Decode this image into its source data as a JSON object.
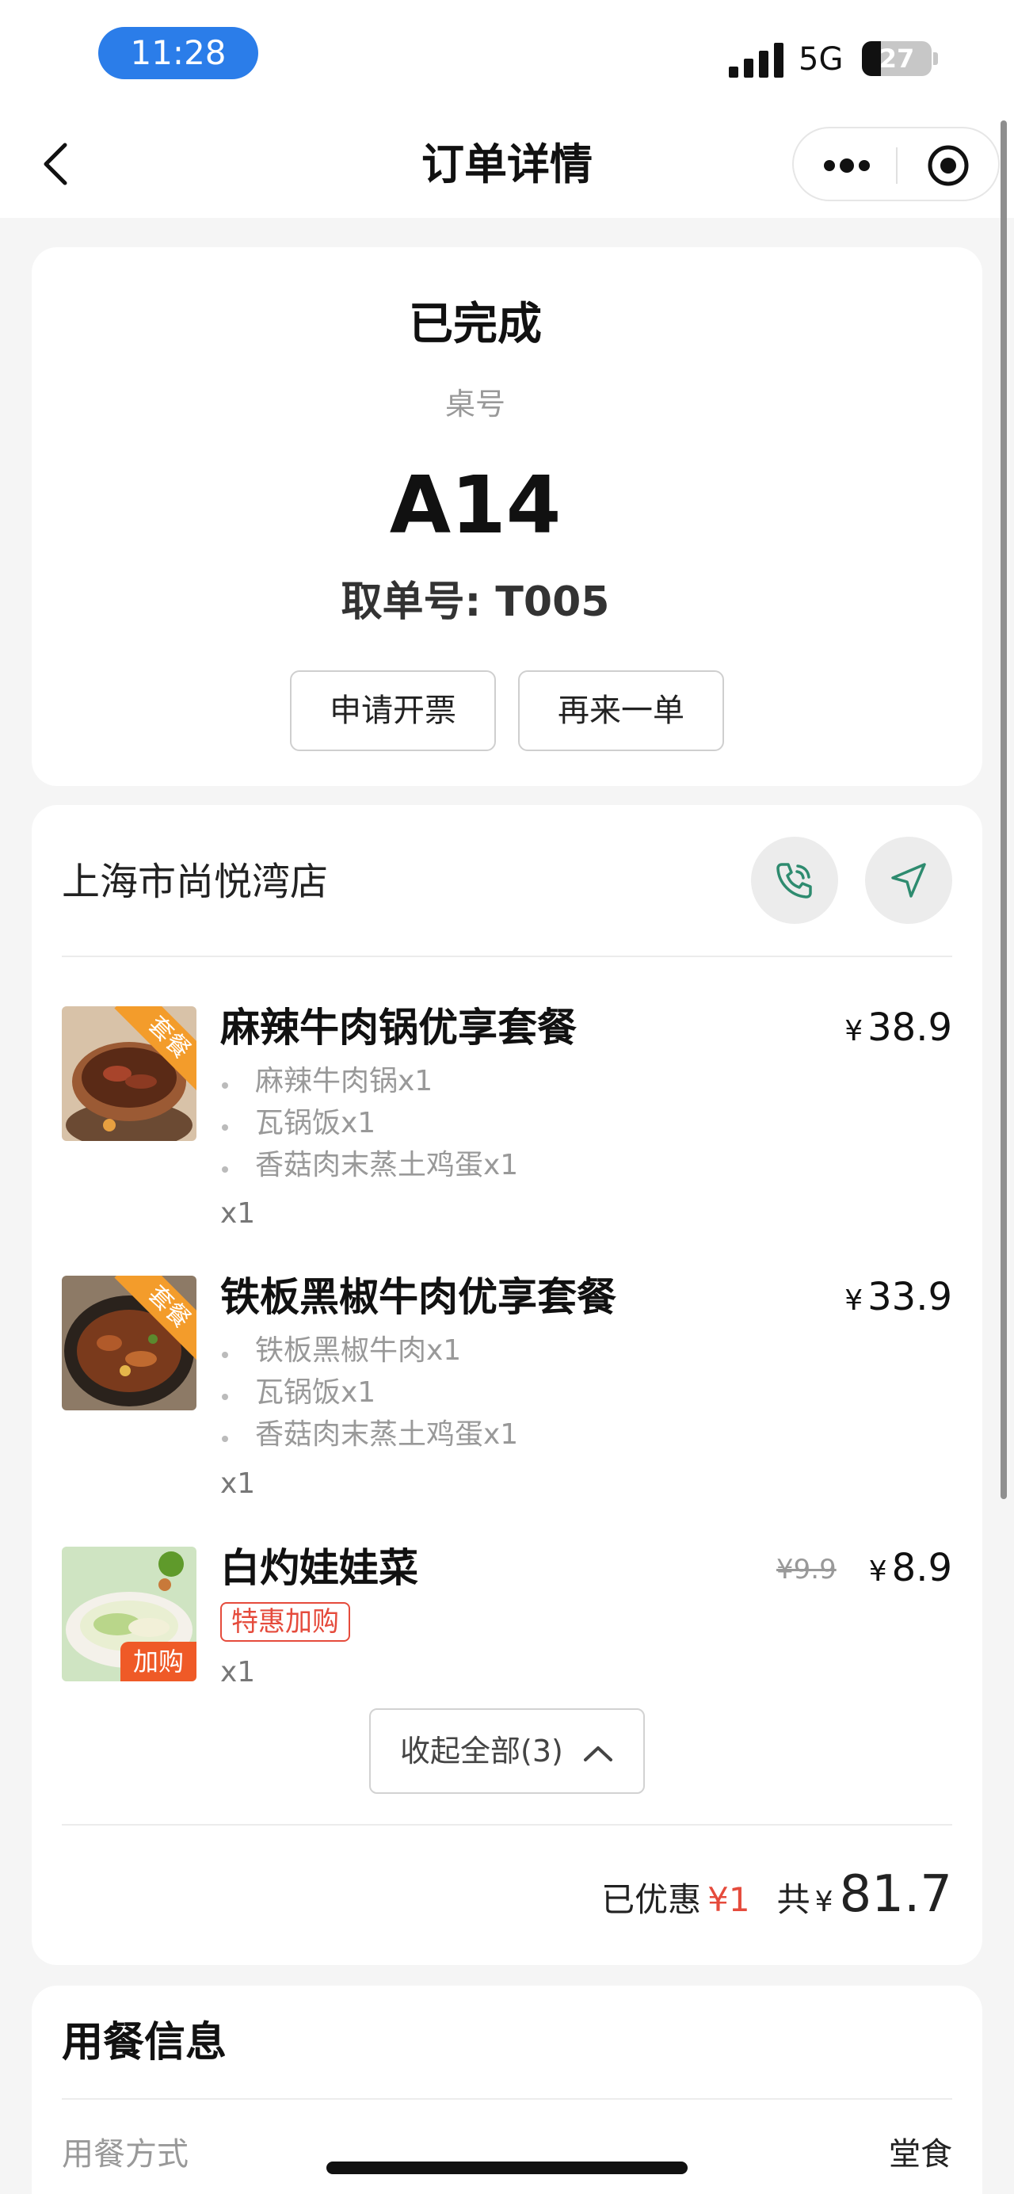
{
  "status_bar": {
    "time": "11:28",
    "network": "5G",
    "battery": "27",
    "battery_level": 0.27
  },
  "nav": {
    "title": "订单详情"
  },
  "order_status": {
    "status": "已完成",
    "table_label": "桌号",
    "table_number": "A14",
    "pickup": "取单号: T005",
    "invoice_button": "申请开票",
    "reorder_button": "再来一单"
  },
  "store": {
    "name": "上海市尚悦湾店"
  },
  "items": [
    {
      "name": "麻辣牛肉锅优享套餐",
      "price": "38.9",
      "currency": "¥",
      "badge": "套餐",
      "sub_items": [
        "麻辣牛肉锅x1",
        "瓦锅饭x1",
        "香菇肉末蒸土鸡蛋x1"
      ],
      "qty": "x1"
    },
    {
      "name": "铁板黑椒牛肉优享套餐",
      "price": "33.9",
      "currency": "¥",
      "badge": "套餐",
      "sub_items": [
        "铁板黑椒牛肉x1",
        "瓦锅饭x1",
        "香菇肉末蒸土鸡蛋x1"
      ],
      "qty": "x1"
    },
    {
      "name": "白灼娃娃菜",
      "price": "8.9",
      "original_price": "¥9.9",
      "currency": "¥",
      "badge": "加购",
      "promo_tag": "特惠加购",
      "qty": "x1"
    }
  ],
  "collapse_button": "收起全部(3)",
  "summary": {
    "discount_label": "已优惠",
    "discount_amount": "¥1",
    "total_label": "共",
    "total_currency": "¥",
    "total_amount": "81.7"
  },
  "dining_info": {
    "title": "用餐信息",
    "method_label": "用餐方式",
    "method_value": "堂食"
  },
  "colors": {
    "accent_red": "#e54b3c",
    "time_pill_blue": "#2b7de9",
    "icon_green": "#2e8b6f",
    "badge_orange": "#f39c2b"
  }
}
